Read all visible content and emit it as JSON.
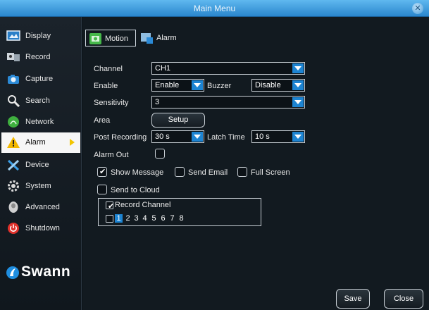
{
  "window": {
    "title": "Main Menu"
  },
  "sidebar": {
    "items": [
      {
        "label": "Display"
      },
      {
        "label": "Record"
      },
      {
        "label": "Capture"
      },
      {
        "label": "Search"
      },
      {
        "label": "Network"
      },
      {
        "label": "Alarm"
      },
      {
        "label": "Device"
      },
      {
        "label": "System"
      },
      {
        "label": "Advanced"
      },
      {
        "label": "Shutdown"
      }
    ],
    "active_item": "Alarm",
    "brand": "Swann"
  },
  "tabs": [
    {
      "label": "Motion",
      "selected": true
    },
    {
      "label": "Alarm",
      "selected": false
    }
  ],
  "form": {
    "channel": {
      "label": "Channel",
      "value": "CH1"
    },
    "enable": {
      "label": "Enable",
      "value": "Enable"
    },
    "buzzer": {
      "label": "Buzzer",
      "value": "Disable"
    },
    "sensitivity": {
      "label": "Sensitivity",
      "value": "3"
    },
    "area": {
      "label": "Area",
      "button": "Setup"
    },
    "post_recording": {
      "label": "Post Recording",
      "value": "30 s"
    },
    "latch_time": {
      "label": "Latch Time",
      "value": "10 s"
    },
    "alarm_out": {
      "label": "Alarm Out",
      "checked": false
    },
    "show_message": {
      "label": "Show Message",
      "checked": true
    },
    "send_email": {
      "label": "Send Email",
      "checked": false
    },
    "full_screen": {
      "label": "Full Screen",
      "checked": false
    },
    "send_to_cloud": {
      "label": "Send to Cloud",
      "checked": false
    },
    "record_channel": {
      "label": "Record Channel",
      "checked": true,
      "all_checked": false,
      "channels": [
        "1",
        "2",
        "3",
        "4",
        "5",
        "6",
        "7",
        "8"
      ],
      "selected_channel": "1"
    }
  },
  "footer": {
    "save": "Save",
    "close": "Close"
  },
  "colors": {
    "accent": "#1d84d2",
    "titlebar": "#3f9fe0",
    "active_arrow": "#f2c500"
  }
}
